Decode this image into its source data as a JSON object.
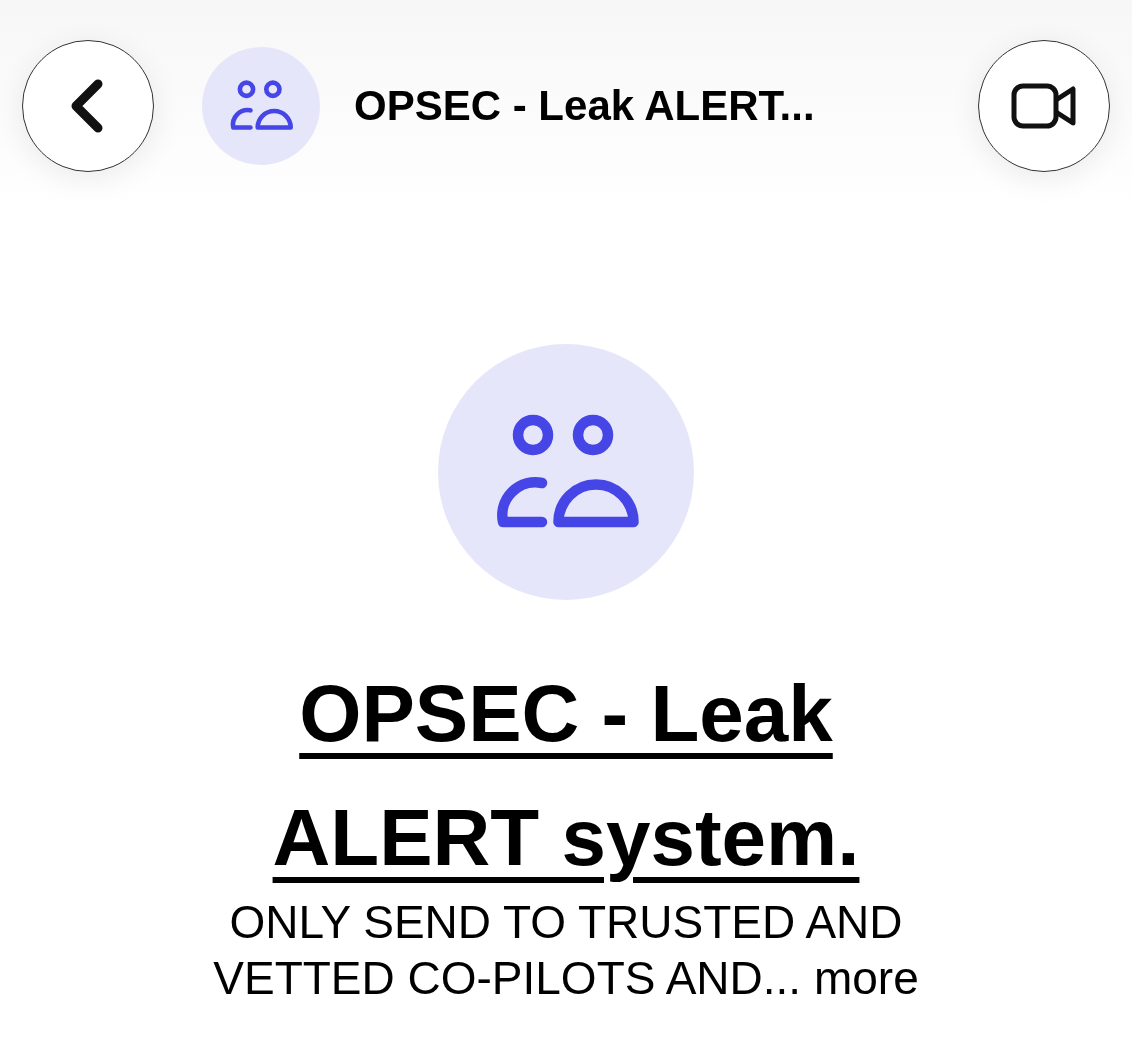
{
  "header": {
    "title": "OPSEC - Leak ALERT..."
  },
  "group": {
    "name": "OPSEC - Leak ALERT system.",
    "description": "ONLY SEND TO TRUSTED AND VETTED CO-PILOTS AND...",
    "more_link": "more"
  }
}
